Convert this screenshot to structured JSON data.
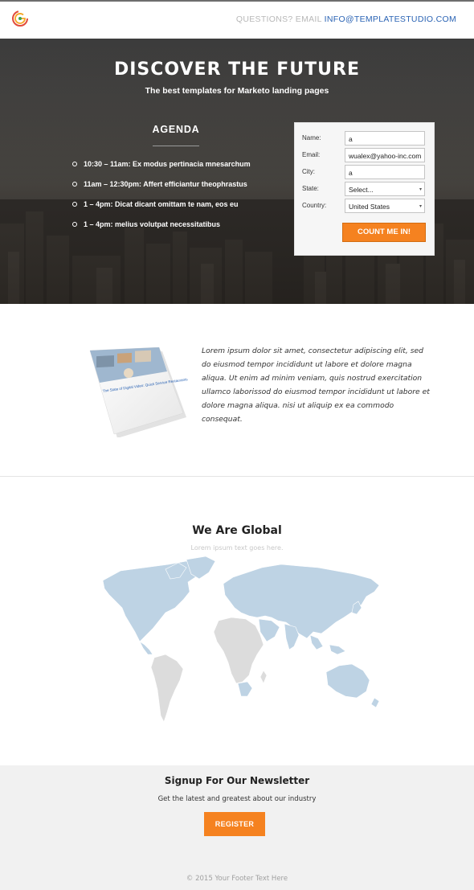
{
  "header": {
    "logo_icon": "templatestudio-logo-icon",
    "contact_prefix": "QUESTIONS? EMAIL ",
    "contact_email": "INFO@TEMPLATESTUDIO.COM"
  },
  "hero": {
    "title": "DISCOVER THE FUTURE",
    "subtitle": "The best templates for Marketo landing pages",
    "agenda_title": "AGENDA",
    "agenda_items": [
      "10:30 – 11am: Ex modus pertinacia mnesarchum",
      "11am – 12:30pm: Affert efficiantur theophrastus",
      "1 – 4pm: Dicat dicant omittam te nam, eos eu",
      "1 – 4pm: melius volutpat necessitatibus"
    ]
  },
  "form": {
    "name_label": "Name:",
    "name_value": "a",
    "email_label": "Email:",
    "email_value": "wualex@yahoo-inc.com",
    "city_label": "City:",
    "city_value": "a",
    "state_label": "State:",
    "state_value": "Select...",
    "country_label": "Country:",
    "country_value": "United States",
    "submit_label": "COUNT ME IN!"
  },
  "ebook": {
    "cover_text": "The State of Digital Video: Quick Service Restaurants",
    "body": "Lorem ipsum dolor sit amet, consectetur adipiscing elit, sed do eiusmod tempor incididunt ut labore et dolore magna aliqua. Ut enim ad minim veniam, quis nostrud exercitation ullamco laborissod do eiusmod tempor incididunt ut labore et dolore magna aliqua. nisi ut aliquip ex ea commodo consequat."
  },
  "global": {
    "title": "We Are Global",
    "subtitle": "Lorem ipsum text goes here."
  },
  "newsletter": {
    "title": "Signup For Our Newsletter",
    "subtitle": "Get the latest and greatest about our industry",
    "button_label": "REGISTER"
  },
  "footer": {
    "text": "© 2015 Your Footer Text Here"
  },
  "colors": {
    "accent": "#f58220",
    "link": "#2a63b4",
    "map_highlight": "#bed3e4",
    "map_muted": "#dcdcdc"
  }
}
